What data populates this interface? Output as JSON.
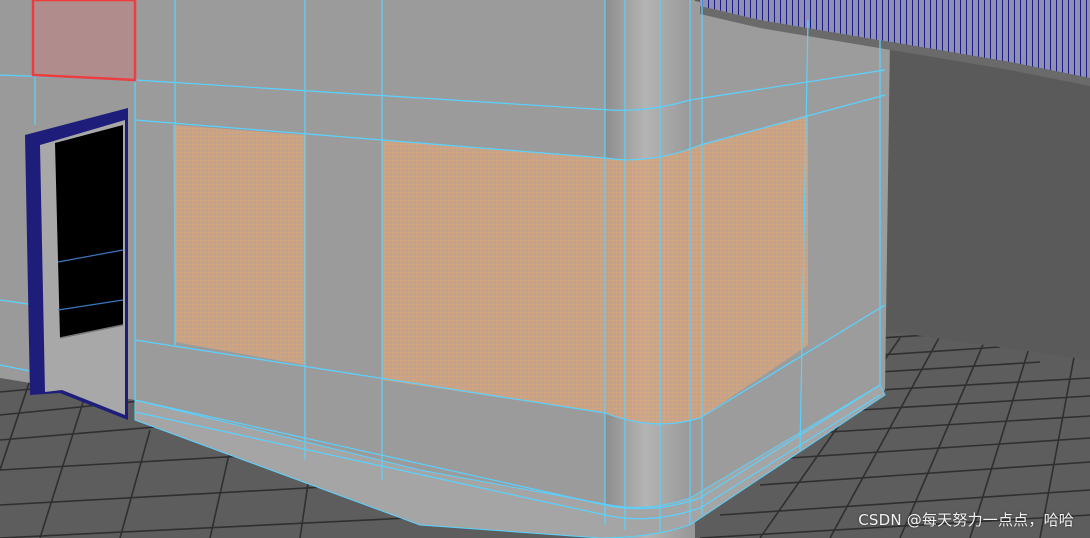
{
  "viewport": {
    "background_color": "#5d5d5d",
    "wall_color": "#999999",
    "edge_color": "#5ad2ff",
    "selected_face_color": "#f3a968",
    "highlight_border_color": "#ff2a2a",
    "doorway_color": "#000000",
    "frame_color": "#20208a"
  },
  "watermark": {
    "text": "CSDN @每天努力一点点，哈哈"
  }
}
